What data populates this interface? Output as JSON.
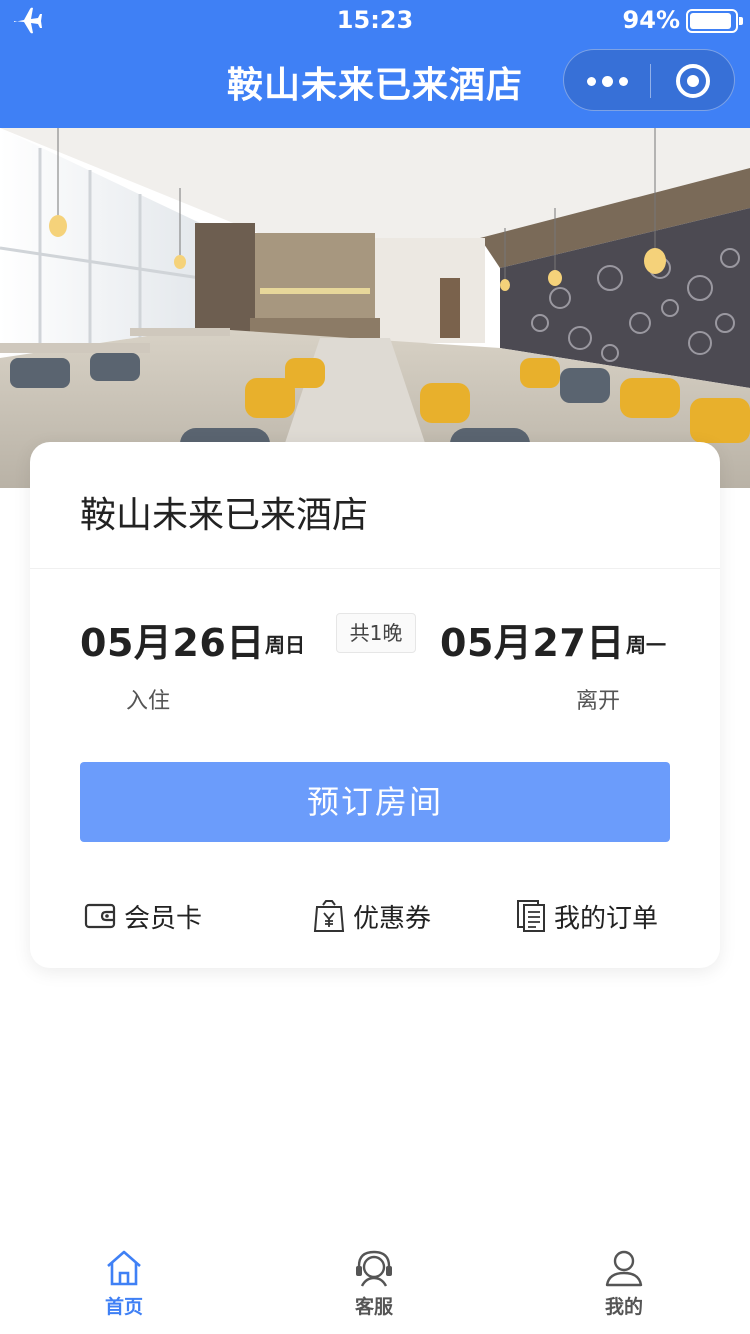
{
  "status_bar": {
    "time": "15:23",
    "battery": "94%",
    "battery_level": 0.94,
    "airplane_icon": "airplane-icon"
  },
  "nav": {
    "title": "鞍山未来已来酒店",
    "more_icon": "more-dots-icon",
    "close_icon": "target-circle-icon"
  },
  "hero": {
    "icon": "restaurant-photo"
  },
  "card": {
    "hotel_name": "鞍山未来已来酒店",
    "checkin": {
      "date": "05月26日",
      "weekday": "周日",
      "label": "入住"
    },
    "nights": "共1晚",
    "checkout": {
      "date": "05月27日",
      "weekday": "周一",
      "label": "离开"
    },
    "book_button": "预订房间",
    "links": [
      {
        "label": "会员卡",
        "icon": "wallet-card-icon"
      },
      {
        "label": "优惠券",
        "icon": "coupon-bag-icon"
      },
      {
        "label": "我的订单",
        "icon": "order-list-icon"
      }
    ]
  },
  "tabbar": {
    "tabs": [
      {
        "label": "首页",
        "icon": "home-icon",
        "active": true
      },
      {
        "label": "客服",
        "icon": "headset-icon",
        "active": false
      },
      {
        "label": "我的",
        "icon": "user-icon",
        "active": false
      }
    ]
  },
  "colors": {
    "primary": "#3f80f5",
    "button": "#6b9cfb",
    "text": "#222222"
  }
}
